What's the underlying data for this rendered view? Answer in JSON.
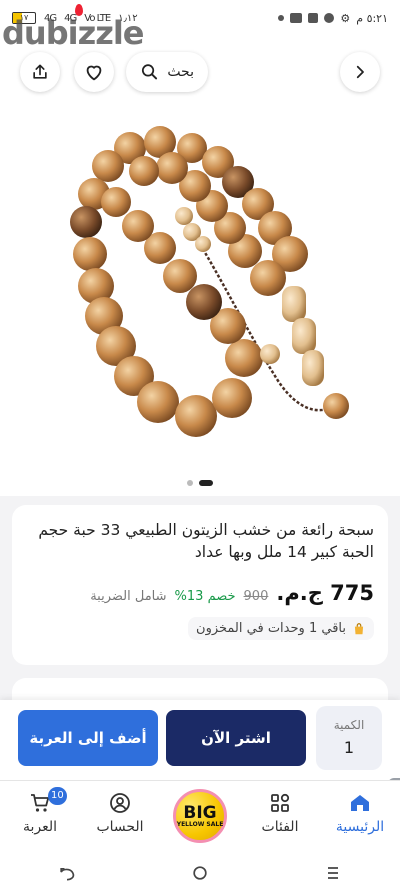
{
  "status_bar": {
    "time": "٥:٢١ م",
    "battery": "١٧",
    "network_labels": [
      "4G",
      "4G",
      "Vo LTE",
      "Vo LTE"
    ],
    "data_speed": "١٫١٢"
  },
  "watermark": {
    "text": "dubizzle"
  },
  "header": {
    "back_icon": "chevron-right-icon",
    "search_label": "بحث",
    "favorite_icon": "heart-icon",
    "share_icon": "share-icon"
  },
  "gallery": {
    "count": 2,
    "active_index": 1
  },
  "product": {
    "title": "سبحة رائعة من خشب الزيتون الطبيعي 33 حبة حجم الحبة كبير 14 ملل وبها عداد",
    "price": "775 ج.م.",
    "old_price": "900",
    "discount": "خصم 13%",
    "tax_note": "شامل الضريبة",
    "stock": "باقي 1 وحدات في المخزون"
  },
  "actions": {
    "quantity_label": "الكمية",
    "quantity_value": "1",
    "buy_now": "اشتر الآن",
    "add_to_cart": "أضف إلى العربة"
  },
  "bottom_nav": {
    "items": [
      {
        "label": "الرئيسية",
        "icon": "home-icon",
        "active": true
      },
      {
        "label": "الفئات",
        "icon": "categories-icon",
        "active": false
      },
      {
        "label": "",
        "icon": "big-yellow-sale-icon",
        "active": false
      },
      {
        "label": "الحساب",
        "icon": "account-icon",
        "active": false
      },
      {
        "label": "العربة",
        "icon": "cart-icon",
        "active": false
      }
    ],
    "cart_badge": "10",
    "sale_big": "BIG",
    "sale_small": "YELLOW SALE"
  },
  "colors": {
    "primary_blue": "#2f6fdc",
    "navy": "#1b2a66",
    "discount_green": "#1a9a4a"
  }
}
